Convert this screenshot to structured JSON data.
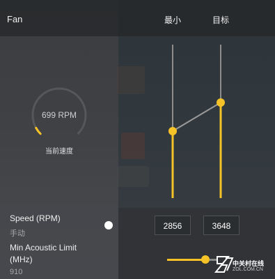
{
  "header": {
    "title": "Fan",
    "col_min": "最小",
    "col_target": "目标"
  },
  "gauge": {
    "value_text": "699 RPM",
    "label": "当前速度",
    "fill_fraction": 0.06
  },
  "fan_curve": {
    "min": {
      "position_fraction": 0.39
    },
    "target": {
      "position_fraction": 0.57
    }
  },
  "speed": {
    "label": "Speed (RPM)",
    "mode": "手动",
    "min_value": "2856",
    "target_value": "3648"
  },
  "acoustic": {
    "label_line1": "Min Acoustic Limit",
    "label_line2": "(MHz)",
    "value": "910",
    "slider_fraction": 0.75
  },
  "watermark": {
    "name": "中关村在线",
    "url": "ZOL.COM.CN"
  },
  "colors": {
    "accent": "#f5c228",
    "track": "#8a8a8a"
  }
}
